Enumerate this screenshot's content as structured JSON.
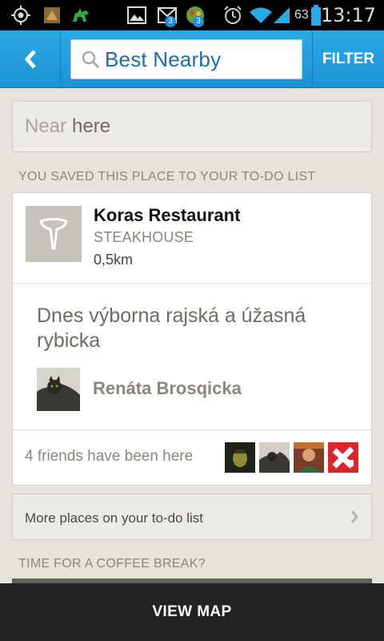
{
  "status_bar": {
    "battery_percent": "63",
    "time": "13:17",
    "icons": [
      "gps-icon",
      "app-icon",
      "dragon-icon",
      "gallery-icon",
      "gmail-icon",
      "app-round-icon",
      "alarm-icon",
      "wifi-icon",
      "signal-icon",
      "battery-icon"
    ],
    "badges": {
      "gmail": "3",
      "app_round": "3"
    }
  },
  "action_bar": {
    "back_icon": "chevron-left-icon",
    "search_icon": "magnifier-icon",
    "search_text": "Best Nearby",
    "filter_label": "FILTER",
    "accent_color": "#1f9ad9"
  },
  "near_field": {
    "label": "Near",
    "value": "here"
  },
  "saved_section": {
    "header": "YOU SAVED THIS PLACE TO YOUR TO-DO LIST",
    "venue": {
      "name": "Koras Restaurant",
      "category": "STEAKHOUSE",
      "distance": "0,5km",
      "icon": "steakhouse-icon"
    },
    "tip": {
      "text": "Dnes výborna rajská a úžasná rybicka",
      "author": "Renáta Brosqicka"
    },
    "friends_text": "4 friends have been here"
  },
  "more_places_label": "More places on your to-do list",
  "coffee_section_header": "TIME FOR A COFFEE BREAK?",
  "bottom_bar": {
    "label": "VIEW MAP"
  }
}
